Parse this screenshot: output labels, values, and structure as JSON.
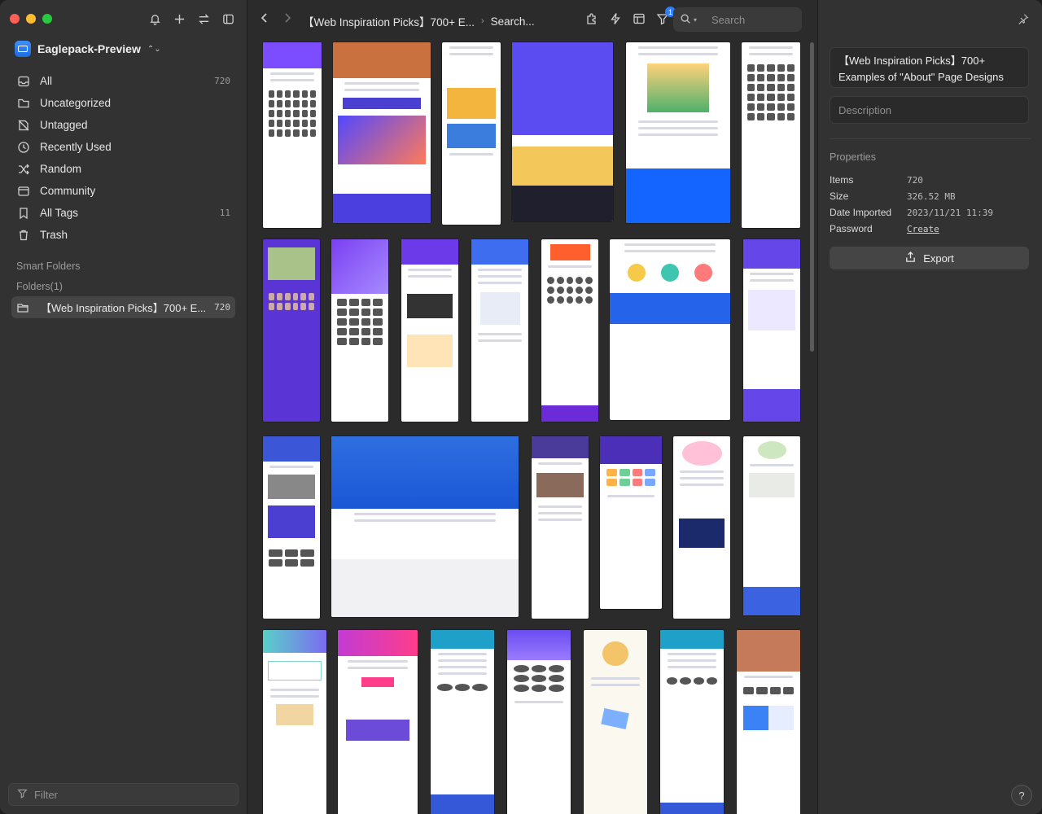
{
  "sidebar": {
    "library_name": "Eaglepack-Preview",
    "items": [
      {
        "label": "All",
        "count": "720",
        "icon": "inbox-icon"
      },
      {
        "label": "Uncategorized",
        "count": "",
        "icon": "folder-question-icon"
      },
      {
        "label": "Untagged",
        "count": "",
        "icon": "tag-off-icon"
      },
      {
        "label": "Recently Used",
        "count": "",
        "icon": "clock-icon"
      },
      {
        "label": "Random",
        "count": "",
        "icon": "shuffle-icon"
      },
      {
        "label": "Community",
        "count": "",
        "icon": "community-icon"
      },
      {
        "label": "All Tags",
        "count": "11",
        "icon": "bookmark-icon"
      },
      {
        "label": "Trash",
        "count": "",
        "icon": "trash-icon"
      }
    ],
    "smart_folders_title": "Smart Folders",
    "folders_title": "Folders(1)",
    "folder": {
      "label": "【Web Inspiration Picks】700+ E...",
      "count": "720"
    },
    "filter_placeholder": "Filter"
  },
  "toolbar": {
    "breadcrumb_folder": "【Web Inspiration Picks】700+ E...",
    "breadcrumb_search": "Search...",
    "filter_badge": "1",
    "search_placeholder": "Search"
  },
  "inspector": {
    "title": "【Web Inspiration Picks】700+ Examples of \"About\" Page Designs",
    "description_placeholder": "Description",
    "properties_title": "Properties",
    "properties": [
      {
        "key": "Items",
        "value": "720"
      },
      {
        "key": "Size",
        "value": "326.52 MB"
      },
      {
        "key": "Date Imported",
        "value": "2023/11/21 11:39"
      },
      {
        "key": "Password",
        "value": "Create"
      }
    ],
    "export_label": "Export",
    "help_label": "?"
  },
  "colors": {
    "accent": "#2f7cf6",
    "sidebar_bg": "#323232",
    "main_bg": "#2b2b2b"
  }
}
